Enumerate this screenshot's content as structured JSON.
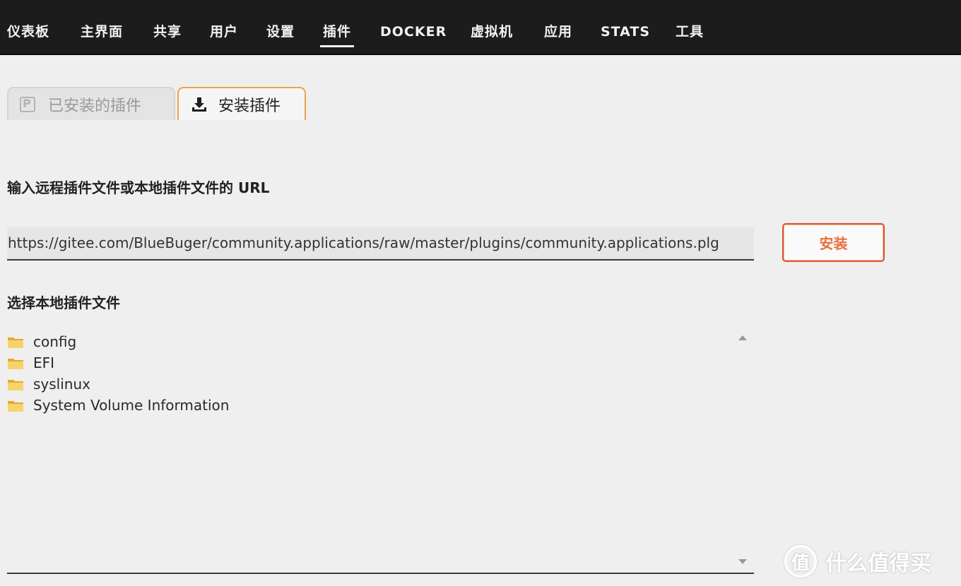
{
  "nav": {
    "items": [
      {
        "label": "仪表板"
      },
      {
        "label": "主界面"
      },
      {
        "label": "共享"
      },
      {
        "label": "用户"
      },
      {
        "label": "设置"
      },
      {
        "label": "插件",
        "active": true
      },
      {
        "label": "DOCKER"
      },
      {
        "label": "虚拟机"
      },
      {
        "label": "应用"
      },
      {
        "label": "STATS"
      },
      {
        "label": "工具"
      }
    ]
  },
  "tabs": {
    "installed": {
      "label": "已安装的插件",
      "icon": "plugin-icon"
    },
    "install": {
      "label": "安装插件",
      "icon": "download-icon",
      "active": true
    }
  },
  "url_section": {
    "title": "输入远程插件文件或本地插件文件的 URL",
    "url_value": "https://gitee.com/BlueBuger/community.applications/raw/master/plugins/community.applications.plg",
    "install_label": "安装"
  },
  "local_section": {
    "title": "选择本地插件文件",
    "folders": [
      {
        "name": "config"
      },
      {
        "name": "EFI"
      },
      {
        "name": "syslinux"
      },
      {
        "name": "System Volume Information"
      }
    ]
  },
  "watermark": {
    "logo": "值",
    "text": "什么值得买"
  },
  "colors": {
    "nav_bg": "#1c1c1c",
    "page_bg": "#efefef",
    "accent_tab": "#f0a14a",
    "install_button_border": "#e0503a",
    "install_button_text": "#e8703a",
    "folder": "#f2c14e"
  }
}
